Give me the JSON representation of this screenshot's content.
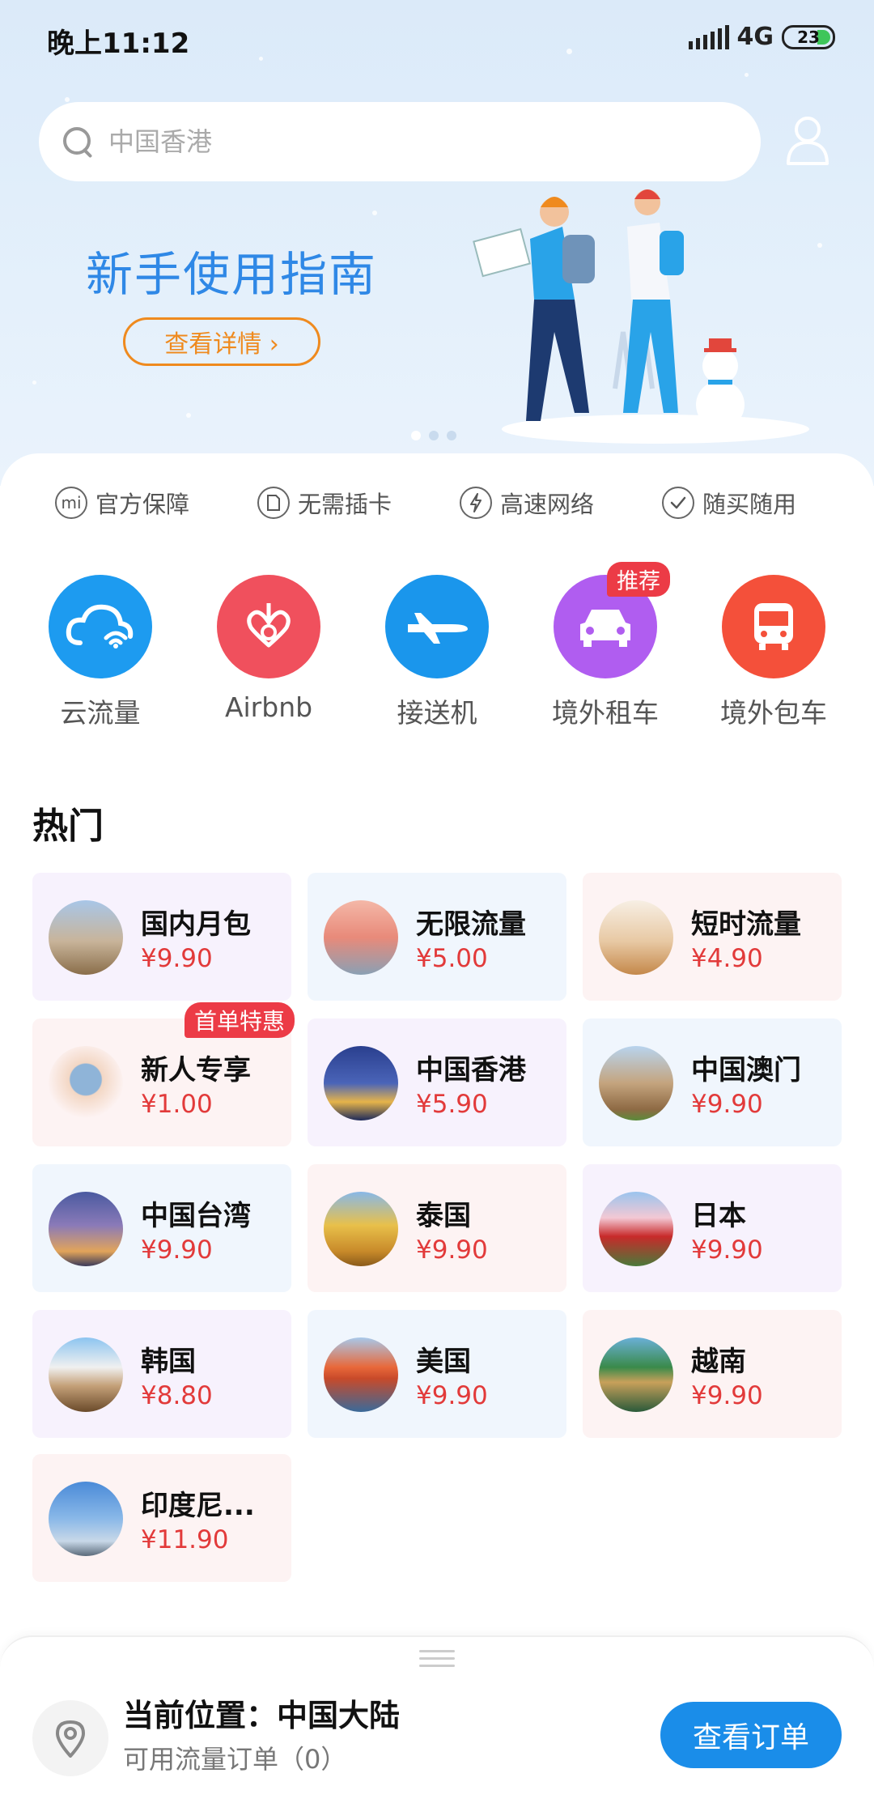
{
  "status_bar": {
    "time": "晚上11:12",
    "network": "4G",
    "battery": "23"
  },
  "search": {
    "placeholder": "中国香港"
  },
  "banner": {
    "title": "新手使用指南",
    "button": "查看详情 ›"
  },
  "features": [
    {
      "icon": "mi-icon",
      "label": "官方保障"
    },
    {
      "icon": "sim-card-icon",
      "label": "无需插卡"
    },
    {
      "icon": "lightning-icon",
      "label": "高速网络"
    },
    {
      "icon": "check-icon",
      "label": "随买随用"
    }
  ],
  "services": [
    {
      "label": "云流量",
      "icon": "cloud-wifi-icon",
      "color": "#1d9bf0"
    },
    {
      "label": "Airbnb",
      "icon": "airbnb-icon",
      "color": "#f0505d"
    },
    {
      "label": "接送机",
      "icon": "airplane-icon",
      "color": "#1a96ec"
    },
    {
      "label": "境外租车",
      "icon": "car-icon",
      "color": "#b05df0",
      "badge": "推荐"
    },
    {
      "label": "境外包车",
      "icon": "bus-icon",
      "color": "#f4503a"
    }
  ],
  "hot": {
    "title": "热门",
    "items": [
      {
        "name": "国内月包",
        "price": "¥9.90"
      },
      {
        "name": "无限流量",
        "price": "¥5.00"
      },
      {
        "name": "短时流量",
        "price": "¥4.90"
      },
      {
        "name": "新人专享",
        "price": "¥1.00",
        "badge": "首单特惠"
      },
      {
        "name": "中国香港",
        "price": "¥5.90"
      },
      {
        "name": "中国澳门",
        "price": "¥9.90"
      },
      {
        "name": "中国台湾",
        "price": "¥9.90"
      },
      {
        "name": "泰国",
        "price": "¥9.90"
      },
      {
        "name": "日本",
        "price": "¥9.90"
      },
      {
        "name": "韩国",
        "price": "¥8.80"
      },
      {
        "name": "美国",
        "price": "¥9.90"
      },
      {
        "name": "越南",
        "price": "¥9.90"
      },
      {
        "name": "印度尼...",
        "price": "¥11.90"
      }
    ]
  },
  "bottom": {
    "location": "当前位置：中国大陆",
    "orders": "可用流量订单（0）",
    "button": "查看订单"
  }
}
